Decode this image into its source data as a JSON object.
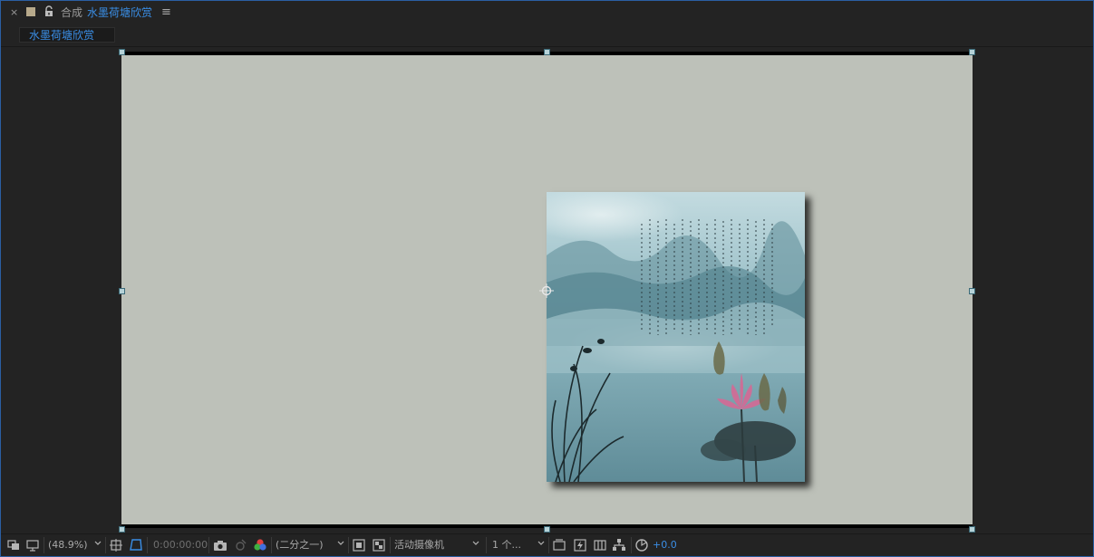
{
  "header": {
    "close_label": "×",
    "panel_label": "合成",
    "comp_name": "水墨荷塘欣赏",
    "menu_label": "≡"
  },
  "tab": {
    "label": "水墨荷塘欣赏"
  },
  "viewer": {
    "canvas_color": "#bdc1b9",
    "painting_alt": "ink wash lotus pond painting"
  },
  "toolbar": {
    "zoom": "(48.9%)",
    "timecode": "0:00:00:00",
    "resolution": "(二分之一)",
    "camera": "活动摄像机",
    "views": "1 个...",
    "exposure": "+0.0"
  },
  "colors": {
    "accent": "#3a8ee6",
    "panel_bg": "#232323",
    "canvas": "#bdc1b9"
  }
}
